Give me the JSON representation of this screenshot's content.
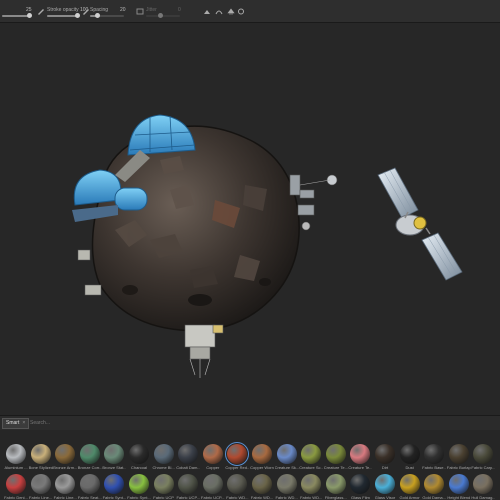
{
  "toolbar": {
    "size_value": "25",
    "stroke_opacity_label": "Stroke opacity",
    "stroke_opacity_value": "100",
    "spacing_label": "Spacing",
    "spacing_value": "20",
    "jitter_label": "Jitter",
    "jitter_value": "0"
  },
  "shelf": {
    "tab_label": "Smart",
    "search_placeholder": "Search...",
    "row1": [
      {
        "label": "Aluminium ...",
        "color": "#b9bcc0"
      },
      {
        "label": "Bone Stylized",
        "color": "#c9b07a"
      },
      {
        "label": "Bronze Arm...",
        "color": "#8a6a3a"
      },
      {
        "label": "Bronze Corr...",
        "color": "#4f8a6a"
      },
      {
        "label": "Bronze Stat...",
        "color": "#6a8a78"
      },
      {
        "label": "Charcoal",
        "color": "#2a2a2a"
      },
      {
        "label": "Chrome Bl...",
        "color": "#5a6a78"
      },
      {
        "label": "Cobalt Dam...",
        "color": "#3a3f48"
      },
      {
        "label": "Copper",
        "color": "#b06a48"
      },
      {
        "label": "Copper Red...",
        "color": "#b04a30"
      },
      {
        "label": "Copper Worn",
        "color": "#a86a40"
      },
      {
        "label": "Creature Sk...",
        "color": "#6a8ac8"
      },
      {
        "label": "Creature Sc...",
        "color": "#8a9a40"
      },
      {
        "label": "Creature Te...",
        "color": "#7a8a3a"
      },
      {
        "label": "Creature Te...",
        "color": "#d87a80"
      },
      {
        "label": "Dirt",
        "color": "#3a3028"
      },
      {
        "label": "Dust",
        "color": "#222222"
      },
      {
        "label": "Fabric Base...",
        "color": "#303030"
      },
      {
        "label": "Fabric Burlap",
        "color": "#4a4030"
      },
      {
        "label": "Fabric Carp...",
        "color": "#4a4a3a"
      }
    ],
    "row2": [
      {
        "label": "Fabric Deni...",
        "color": "#c84040"
      },
      {
        "label": "Fabric Line...",
        "color": "#7a7a7a"
      },
      {
        "label": "Fabric Line...",
        "color": "#9a9a9a"
      },
      {
        "label": "Fabric Seat...",
        "color": "#6a6a6a"
      },
      {
        "label": "Fabric Synt...",
        "color": "#3050b0"
      },
      {
        "label": "Fabric Synt...",
        "color": "#88c040"
      },
      {
        "label": "Fabric UCP",
        "color": "#7a8060"
      },
      {
        "label": "Fabric UCP...",
        "color": "#505448"
      },
      {
        "label": "Fabric UCP...",
        "color": "#6a6e64"
      },
      {
        "label": "Fabric WD...",
        "color": "#5a5a50"
      },
      {
        "label": "Fabric WD...",
        "color": "#6a6448"
      },
      {
        "label": "Fabric WD...",
        "color": "#7a7a6a"
      },
      {
        "label": "Fabric WD...",
        "color": "#8a8a60"
      },
      {
        "label": "Fiberglass...",
        "color": "#8a9a6a"
      },
      {
        "label": "Glass Film",
        "color": "#202830"
      },
      {
        "label": "Glass Visor",
        "color": "#4ab0d8"
      },
      {
        "label": "Gold Armor",
        "color": "#c8a020"
      },
      {
        "label": "Gold Dama...",
        "color": "#b08a30"
      },
      {
        "label": "Height Blend",
        "color": "#4a7ad0"
      },
      {
        "label": "Hull Damag...",
        "color": "#7a7060"
      }
    ]
  }
}
